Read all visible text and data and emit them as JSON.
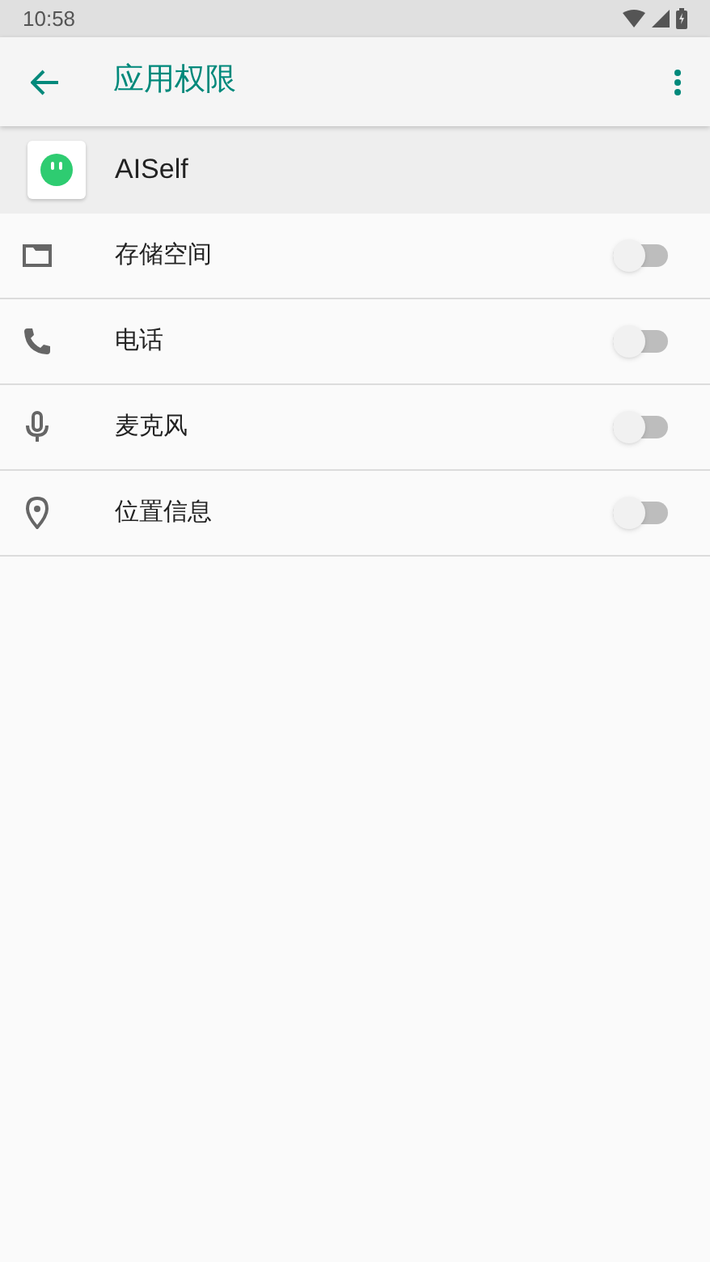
{
  "status_bar": {
    "time": "10:58"
  },
  "app_bar": {
    "title": "应用权限"
  },
  "app": {
    "name": "AISelf"
  },
  "permissions": [
    {
      "kind": "storage",
      "label": "存储空间",
      "on": false
    },
    {
      "kind": "phone",
      "label": "电话",
      "on": false
    },
    {
      "kind": "microphone",
      "label": "麦克风",
      "on": false
    },
    {
      "kind": "location",
      "label": "位置信息",
      "on": false
    }
  ]
}
